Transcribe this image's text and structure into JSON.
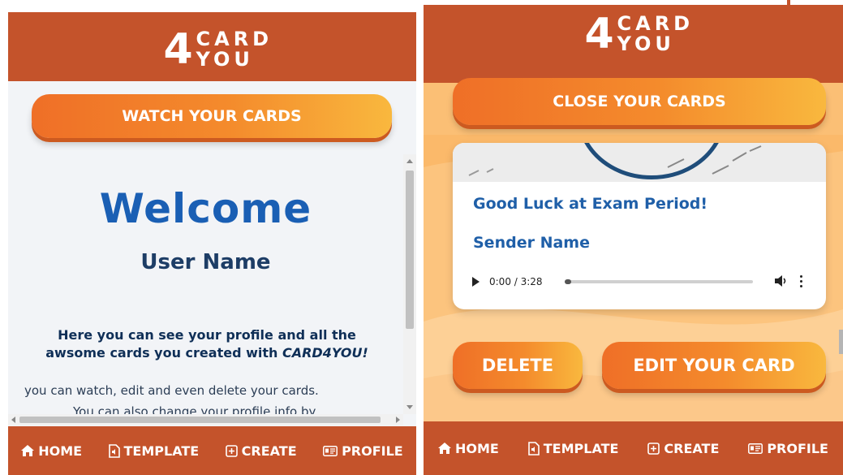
{
  "left": {
    "logo": {
      "four": "4",
      "card": "CARD",
      "you": "YOU"
    },
    "main_button": "WATCH YOUR CARDS",
    "welcome": "Welcome",
    "user_name": "User Name",
    "desc_main_pre": "Here you can see your profile and all the awsome cards you created with ",
    "desc_brand": "CARD4YOU!",
    "desc_sub": "you can watch, edit and even delete your cards.",
    "desc_sub2": "You can also change your profile info by",
    "nav": {
      "home": "HOME",
      "template": "TEMPLATE",
      "create": "CREATE",
      "profile": "PROFILE"
    }
  },
  "right": {
    "logo": {
      "four": "4",
      "card": "CARD",
      "you": "YOU"
    },
    "main_button": "CLOSE YOUR CARDS",
    "card": {
      "title": "Good Luck at Exam Period!",
      "sender": "Sender Name",
      "audio_time": "0:00 / 3:28",
      "audio_progress": 0
    },
    "delete_button": "DELETE",
    "edit_button": "EDIT YOUR CARD",
    "nav": {
      "home": "HOME",
      "template": "TEMPLATE",
      "create": "CREATE",
      "profile": "PROFILE"
    }
  },
  "colors": {
    "brand": "#c4532b",
    "title_blue": "#1a5fb4",
    "button_start": "#ef6f27",
    "button_end": "#f9b83e"
  }
}
